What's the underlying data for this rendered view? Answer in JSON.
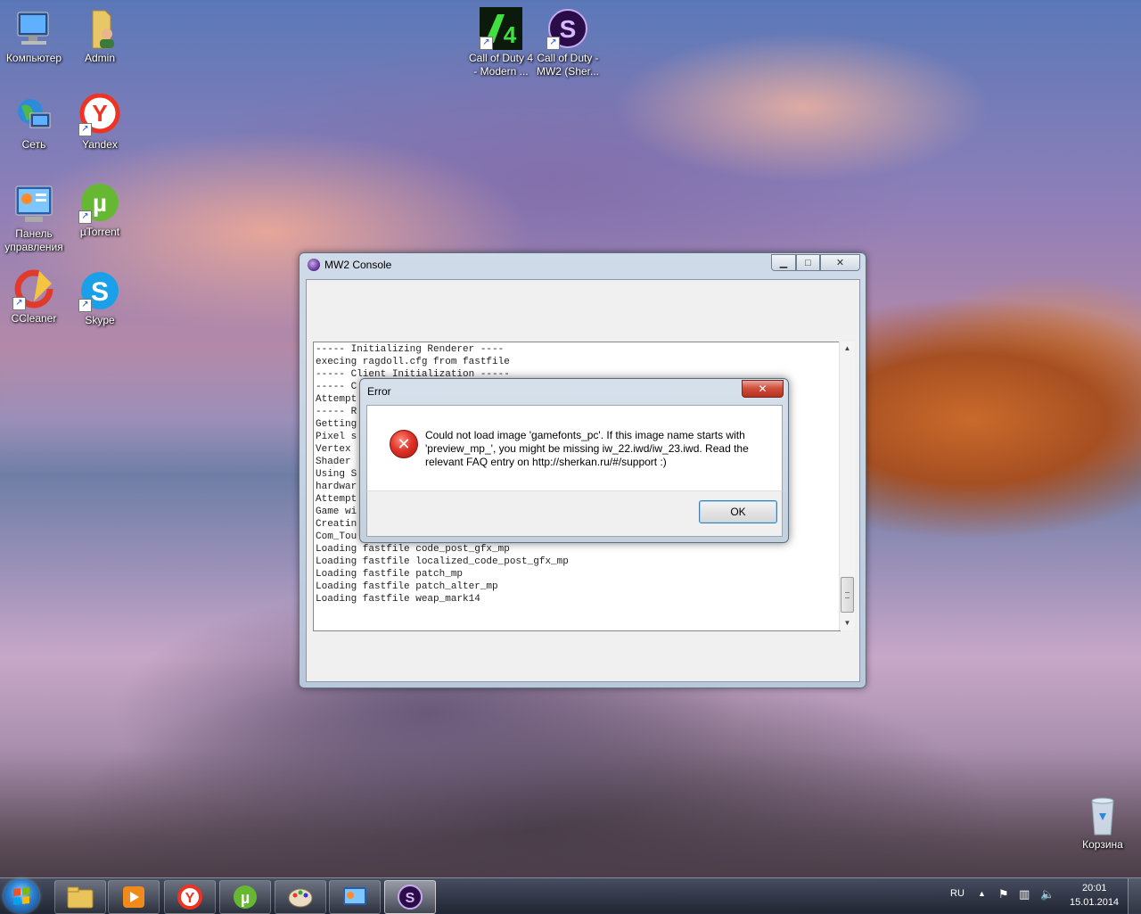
{
  "desktop": {
    "icons": [
      {
        "label": "Компьютер"
      },
      {
        "label": "Admin"
      },
      {
        "label": "Сеть"
      },
      {
        "label": "Yandex"
      },
      {
        "label": "Панель управления"
      },
      {
        "label": "µTorrent"
      },
      {
        "label": "CCleaner"
      },
      {
        "label": "Skype"
      },
      {
        "label": "Call of Duty 4 - Modern ..."
      },
      {
        "label": "Call of Duty - MW2 (Sher..."
      },
      {
        "label": "Корзина"
      }
    ]
  },
  "console": {
    "title": "MW2 Console",
    "log": "----- Initializing Renderer ----\nexecing ragdoll.cfg from fastfile\n----- Client Initialization -----\n----- C\nAttempt\n----- R\nGetting\nPixel s\nVertex \nShader \nUsing S                                                               is\nhardwar\nAttempt\nGame wi\nCreatin\nCom_Tou\nLoading fastfile code_post_gfx_mp\nLoading fastfile localized_code_post_gfx_mp\nLoading fastfile patch_mp\nLoading fastfile patch_alter_mp\nLoading fastfile weap_mark14"
  },
  "error_dialog": {
    "title": "Error",
    "message": "Could not load image 'gamefonts_pc'. If this image name starts with 'preview_mp_', you might be missing iw_22.iwd/iw_23.iwd. Read the relevant FAQ entry on http://sherkan.ru/#/support :)",
    "ok_label": "OK",
    "close_glyph": "✕"
  },
  "taskbar": {
    "language": "RU",
    "time": "20:01",
    "date": "15.01.2014"
  },
  "colors": {
    "accent": "#3c7fb1",
    "error_red": "#e0352a"
  }
}
